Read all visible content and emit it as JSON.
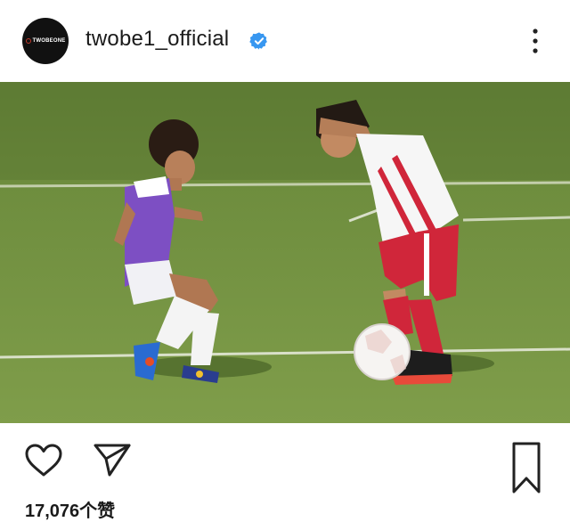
{
  "post": {
    "username": "twobe1_official",
    "verified": true,
    "avatar_text": "TWOBEONE",
    "image": {
      "description_icon": "soccer-photo",
      "jersey_left": "purple-white",
      "jersey_right": "red-white"
    },
    "likes_text": "17,076个赞"
  },
  "icons": {
    "verified": "verified-badge-icon",
    "more": "more-vertical-icon",
    "like": "heart-icon",
    "share": "send-icon",
    "save": "bookmark-icon"
  },
  "colors": {
    "verified_blue": "#3897f0",
    "grass": "#7a9a45",
    "avatar_bg": "#111111"
  }
}
